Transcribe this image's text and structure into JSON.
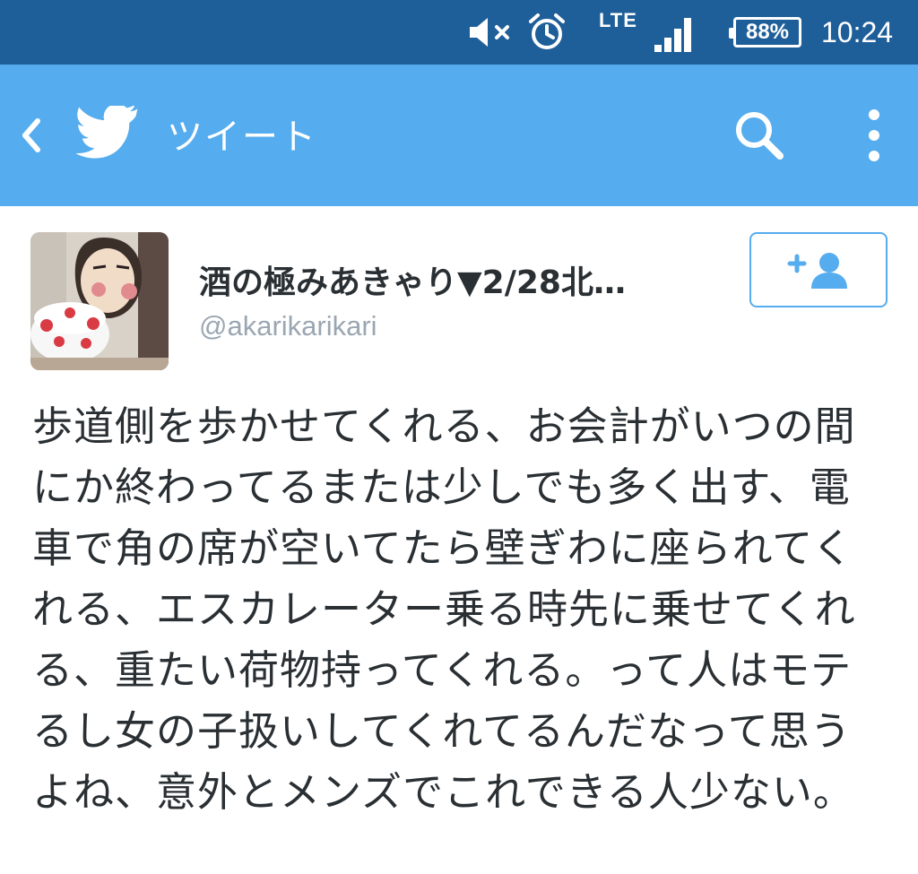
{
  "status_bar": {
    "network": "LTE",
    "battery": "88%",
    "time": "10:24",
    "icons": [
      "mute-icon",
      "alarm-icon",
      "signal-icon",
      "battery-icon"
    ]
  },
  "app_bar": {
    "title": "ツイート",
    "icons": [
      "back-icon",
      "twitter-bird-icon",
      "search-icon",
      "more-vertical-icon"
    ]
  },
  "tweet": {
    "display_name": "酒の極みあきゃり▼2/28北…",
    "handle": "@akarikarikari",
    "text": "歩道側を歩かせてくれる、お会計がいつの間にか終わってるまたは少しでも多く出す、電車で角の席が空いてたら壁ぎわに座られてくれる、エスカレーター乗る時先に乗せてくれる、重たい荷物持ってくれる。って人はモテるし女の子扱いしてくれてるんだなって思うよね、意外とメンズでこれできる人少ない。",
    "follow_icon": "add-user-icon"
  },
  "colors": {
    "status_bar": "#1f5f99",
    "app_bar": "#55acee",
    "text": "#292f33",
    "handle": "#9aa7b2"
  }
}
